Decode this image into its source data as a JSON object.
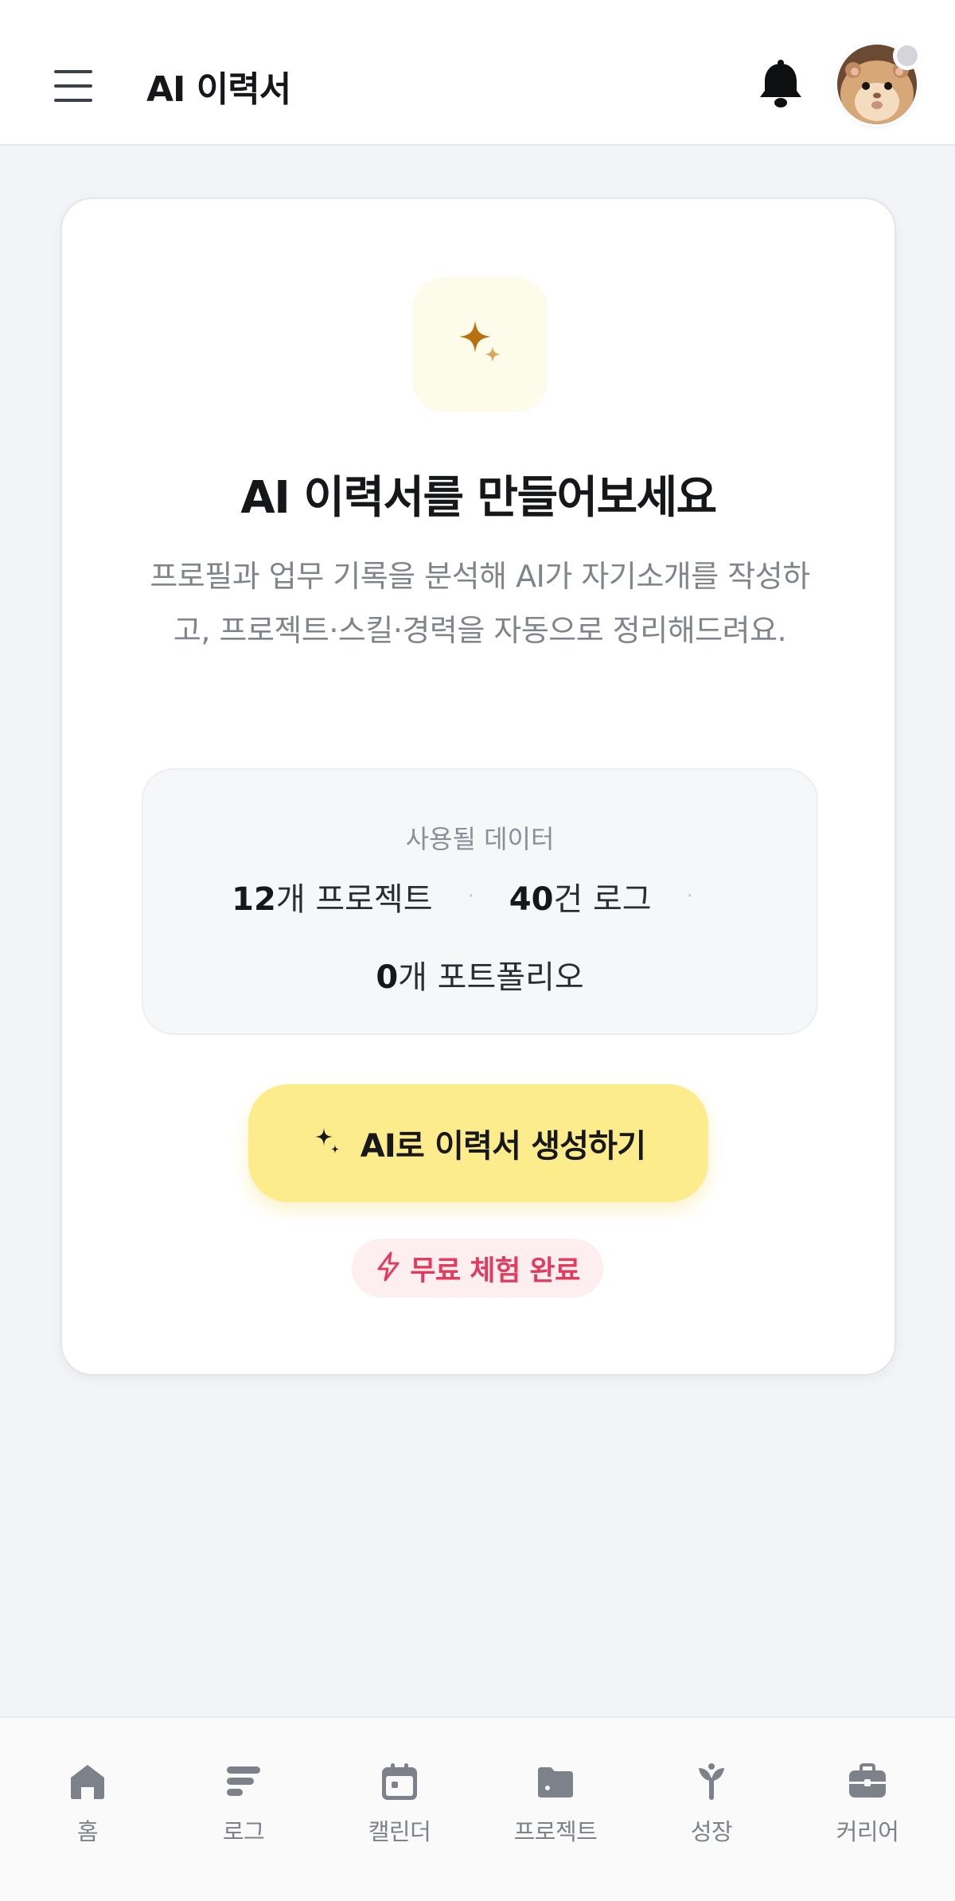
{
  "header": {
    "title": "AI 이력서",
    "menu_icon": "hamburger-menu-icon",
    "notification_icon": "bell-icon",
    "avatar": "hamster-avatar"
  },
  "card": {
    "title": "AI 이력서를 만들어보세요",
    "description": "프로필과 업무 기록을 분석해 AI가 자기소개를 작성하고, 프로젝트·스킬·경력을 자동으로 정리해드려요.",
    "data_summary": {
      "label": "사용될 데이터",
      "projects_count": "12",
      "projects_unit": "개 프로젝트",
      "logs_count": "40",
      "logs_unit": "건 로그",
      "portfolio_count": "0",
      "portfolio_unit": "개 포트폴리오",
      "separator": "·"
    },
    "cta_label": "AI로 이력서 생성하기",
    "trial_badge": "무료 체험 완료"
  },
  "bottom_nav": {
    "items": [
      {
        "label": "홈",
        "icon": "home-icon"
      },
      {
        "label": "로그",
        "icon": "log-lines-icon"
      },
      {
        "label": "캘린더",
        "icon": "calendar-icon"
      },
      {
        "label": "프로젝트",
        "icon": "folder-icon"
      },
      {
        "label": "성장",
        "icon": "sprout-icon"
      },
      {
        "label": "커리어",
        "icon": "briefcase-icon"
      }
    ]
  },
  "colors": {
    "accent_yellow": "#fdec8c",
    "sparkle": "#b8710e",
    "trial_red": "#e33a60",
    "nav_gray": "#7d818a"
  }
}
